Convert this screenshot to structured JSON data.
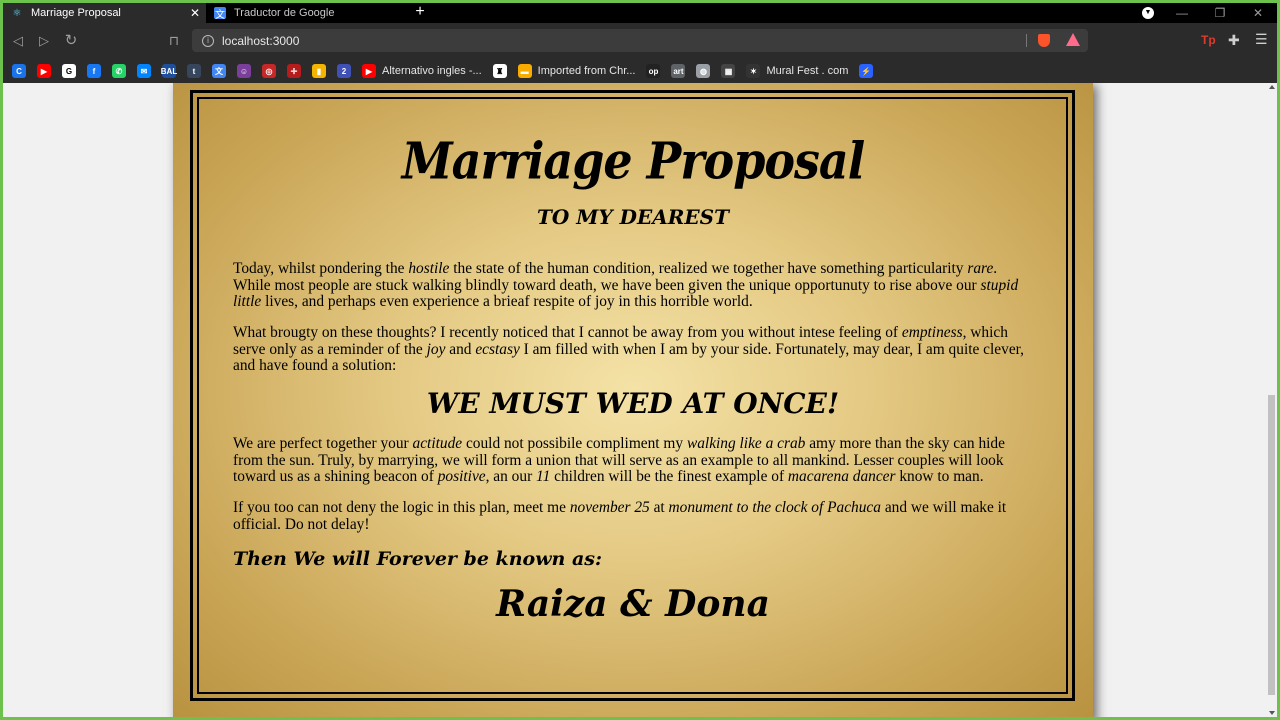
{
  "browser": {
    "tabs": [
      {
        "title": "Marriage Proposal",
        "active": true
      },
      {
        "title": "Traductor de Google",
        "active": false
      }
    ],
    "new_tab": "+",
    "address": "localhost:3000",
    "window_controls": [
      "—",
      "❐",
      "✕"
    ],
    "ext_tp": "Tp"
  },
  "bookmarks": [
    {
      "icon": "c-icon",
      "color": "#1a73e8",
      "glyph": "C",
      "label": ""
    },
    {
      "icon": "youtube-icon",
      "color": "#ff0000",
      "glyph": "▶",
      "label": ""
    },
    {
      "icon": "google-icon",
      "color": "#ffffff",
      "glyph": "G",
      "label": ""
    },
    {
      "icon": "facebook-icon",
      "color": "#1877f2",
      "glyph": "f",
      "label": ""
    },
    {
      "icon": "whatsapp-icon",
      "color": "#25d366",
      "glyph": "✆",
      "label": ""
    },
    {
      "icon": "messenger-icon",
      "color": "#0084ff",
      "glyph": "✉",
      "label": ""
    },
    {
      "icon": "bal-icon",
      "color": "#1f4e9c",
      "glyph": "BAL",
      "label": ""
    },
    {
      "icon": "tumblr-icon",
      "color": "#36465d",
      "glyph": "t",
      "label": ""
    },
    {
      "icon": "translate-icon",
      "color": "#4285f4",
      "glyph": "文",
      "label": ""
    },
    {
      "icon": "avatar-icon",
      "color": "#7a3f9a",
      "glyph": "☺",
      "label": ""
    },
    {
      "icon": "target-icon",
      "color": "#c62828",
      "glyph": "◎",
      "label": ""
    },
    {
      "icon": "crosshair-icon",
      "color": "#b71c1c",
      "glyph": "✛",
      "label": ""
    },
    {
      "icon": "bars-icon",
      "color": "#f4b400",
      "glyph": "▮",
      "label": ""
    },
    {
      "icon": "calendar-icon",
      "color": "#3f51b5",
      "glyph": "2",
      "label": ""
    },
    {
      "icon": "youtube-icon",
      "color": "#ff0000",
      "glyph": "▶",
      "label": "Alternativo ingles -..."
    },
    {
      "icon": "bookmark-icon",
      "color": "#ffffff",
      "glyph": "♜",
      "label": ""
    },
    {
      "icon": "folder-icon",
      "color": "#f9ab00",
      "glyph": "▬",
      "label": "Imported from Chr..."
    },
    {
      "icon": "op-icon",
      "color": "#222222",
      "glyph": "op",
      "label": ""
    },
    {
      "icon": "art-icon",
      "color": "#5f6368",
      "glyph": "art",
      "label": ""
    },
    {
      "icon": "globe-icon",
      "color": "#9aa0a6",
      "glyph": "◍",
      "label": ""
    },
    {
      "icon": "grid-icon",
      "color": "#444444",
      "glyph": "▦",
      "label": ""
    },
    {
      "icon": "mural-icon",
      "color": "#333333",
      "glyph": "✶",
      "label": "Mural Fest . com"
    },
    {
      "icon": "bolt-icon",
      "color": "#2962ff",
      "glyph": "⚡",
      "label": ""
    }
  ],
  "letter": {
    "title": "Marriage Proposal",
    "subtitle": "TO MY DEAREST",
    "p1": {
      "a": "Today, whilst pondering the ",
      "b": "hostile",
      "c": " the state of the human condition, realized we together have something particularity ",
      "d": "rare",
      "e": ". While most people are stuck walking blindly toward death, we have been given the unique opportunuty to rise above our ",
      "f": "stupid little",
      "g": " lives, and perhaps even experience a brieaf respite of joy in this horrible world."
    },
    "p2": {
      "a": "What brougty on these thoughts? I recently noticed that I cannot be away from you without intese feeling of ",
      "b": "emptiness",
      "c": ", which serve only as a reminder of the ",
      "d": "joy",
      "e": " and ",
      "f": "ecstasy",
      "g": " I am filled with when I am by your side. Fortunately, may dear, I am quite clever, and have found a solution:"
    },
    "exclaim": "WE MUST WED AT ONCE!",
    "p3": {
      "a": "We are perfect together your ",
      "b": "actitude",
      "c": " could not possibile compliment my ",
      "d": "walking like a crab",
      "e": " amy more than the sky can hide from the sun. Truly, by marrying, we will form a union that will serve as an example to all mankind. Lesser couples will look toward us as a shining beacon of ",
      "f": "positive",
      "g": ", an our ",
      "h": "11",
      "i": " children will be the finest example of ",
      "j": "macarena dancer",
      "k": " know to man."
    },
    "p4": {
      "a": "If you too can not deny the logic in this plan, meet me ",
      "b": "november 25",
      "c": " at ",
      "d": "monument to the clock of Pachuca",
      "e": " and we will make it official. Do not delay!"
    },
    "known_as": "Then We will Forever be known as:",
    "signature": "Raiza & Dona"
  }
}
